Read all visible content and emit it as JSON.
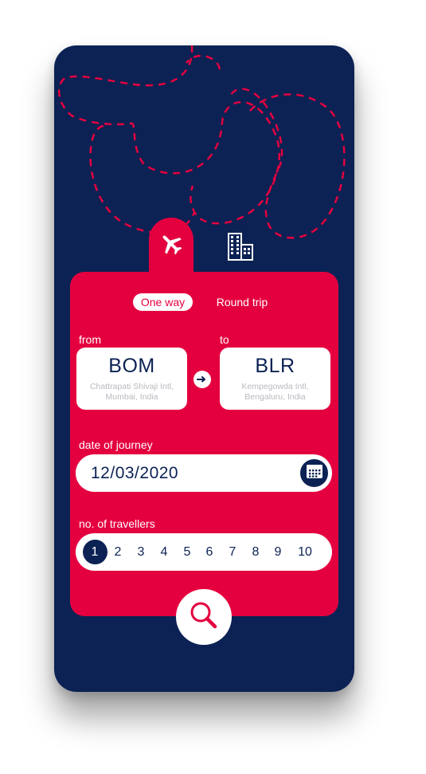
{
  "colors": {
    "background": "#0c2254",
    "accent": "#e4003f",
    "surface": "#ffffff",
    "muted_text": "#b9b9c0"
  },
  "modes": [
    {
      "icon": "airplane-icon",
      "selected": true
    },
    {
      "icon": "building-icon",
      "selected": false
    }
  ],
  "trip_type": {
    "one_way": "One way",
    "round_trip": "Round trip",
    "selected": "one_way"
  },
  "from": {
    "label": "from",
    "code": "BOM",
    "name": "Chattrapati Shivaji Intl, Mumbai, India"
  },
  "to": {
    "label": "to",
    "code": "BLR",
    "name": "Kempegowda Intl, Bengaluru, India"
  },
  "swap_icon": "arrow-right-icon",
  "date": {
    "label": "date of journey",
    "value": "12/03/2020",
    "icon": "calendar-icon"
  },
  "travellers": {
    "label": "no. of travellers",
    "options": [
      "1",
      "2",
      "3",
      "4",
      "5",
      "6",
      "7",
      "8",
      "9",
      "10"
    ],
    "selected": "1"
  },
  "search_icon": "search-icon"
}
